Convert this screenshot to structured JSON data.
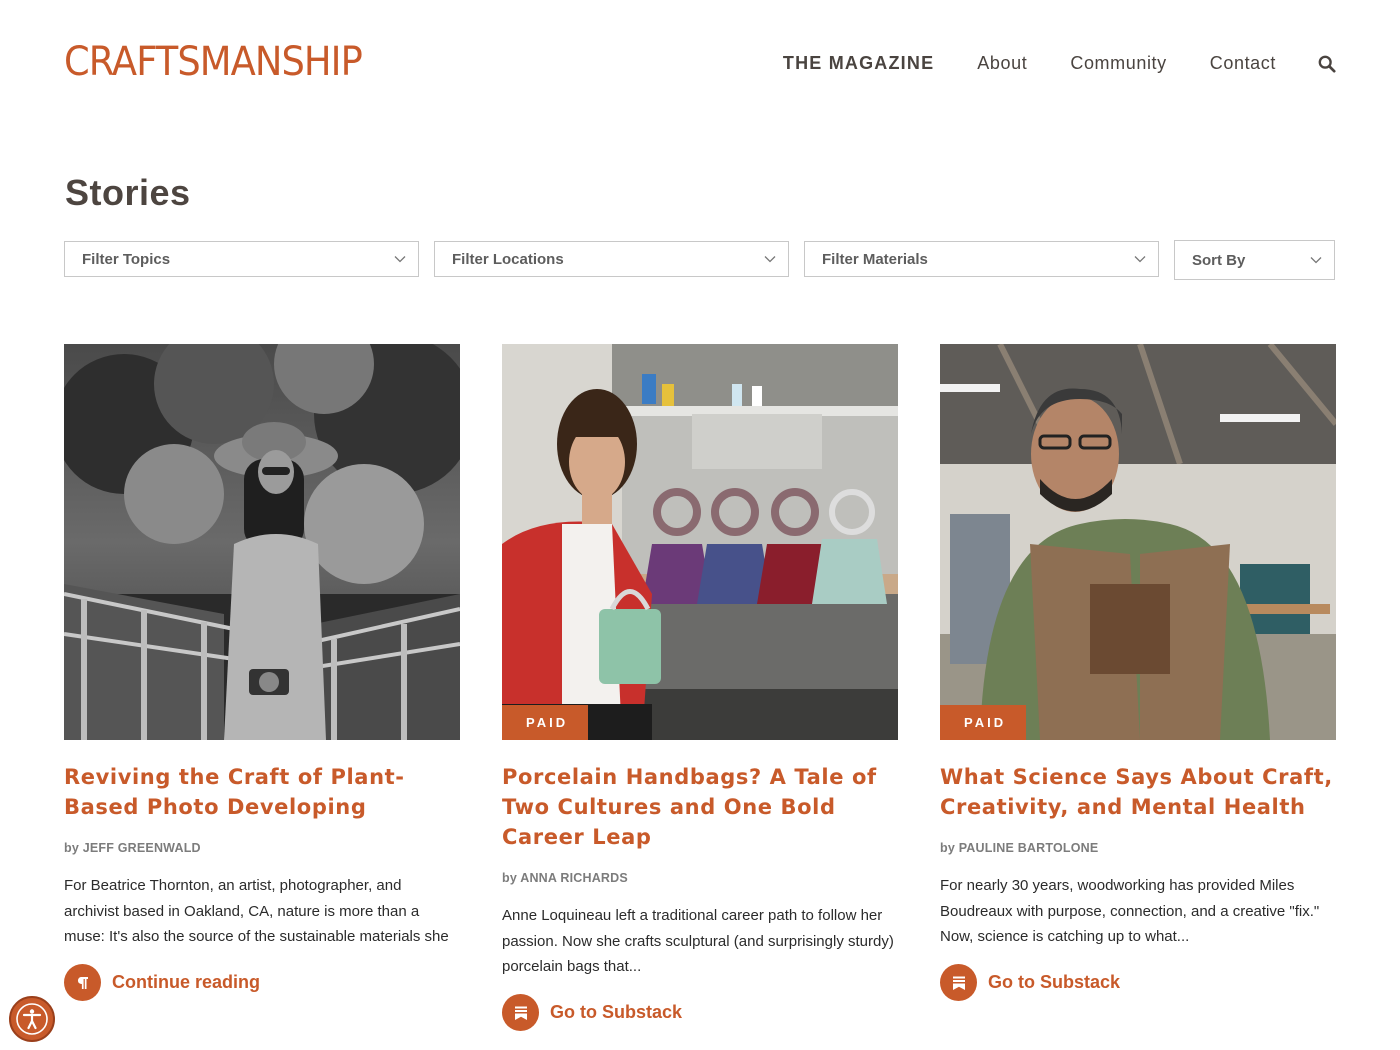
{
  "brand": {
    "logo_text": "CRAFTSMANSHIP",
    "accent_color": "#c85a2a"
  },
  "nav": {
    "items": [
      {
        "label": "THE MAGAZINE"
      },
      {
        "label": "About"
      },
      {
        "label": "Community"
      },
      {
        "label": "Contact"
      }
    ],
    "search_icon": "search-icon"
  },
  "page": {
    "title": "Stories"
  },
  "filters": [
    {
      "label": "Filter Topics"
    },
    {
      "label": "Filter Locations"
    },
    {
      "label": "Filter Materials"
    },
    {
      "label": "Sort By"
    }
  ],
  "cards": [
    {
      "image": "black-and-white photo of a woman in a wide-brim hat with a camera",
      "badge": "",
      "title": "Reviving the Craft of Plant-Based Photo Developing",
      "by": "by",
      "author": "JEFF GREENWALD",
      "excerpt": "For Beatrice Thornton, an artist, photographer, and archivist based in Oakland, CA, nature is more than a muse: It's also the source of the sustainable materials she uses for devel…",
      "cta_label": "Continue reading",
      "cta_icon": "pilcrow-icon"
    },
    {
      "image": "woman in red jacket holding a porcelain handbag",
      "badge": "PAID",
      "title": "Porcelain Handbags? A Tale of Two Cultures and One Bold Career Leap",
      "by": "by",
      "author": "ANNA RICHARDS",
      "excerpt": "Anne Loquineau left a traditional career path to follow her passion. Now she crafts sculptural (and surprisingly sturdy) porcelain bags that...",
      "cta_label": "Go to Substack",
      "cta_icon": "substack-icon"
    },
    {
      "image": "man in green sweater and apron in a woodshop",
      "badge": "PAID",
      "title": "What Science Says About Craft, Creativity, and Mental Health",
      "by": "by",
      "author": "PAULINE BARTOLONE",
      "excerpt": "For nearly 30 years, woodworking has provided Miles Boudreaux with purpose, connection, and a creative \"fix.\" Now, science is catching up to what...",
      "cta_label": "Go to Substack",
      "cta_icon": "substack-icon"
    }
  ],
  "accessibility_button_icon": "accessibility-icon"
}
